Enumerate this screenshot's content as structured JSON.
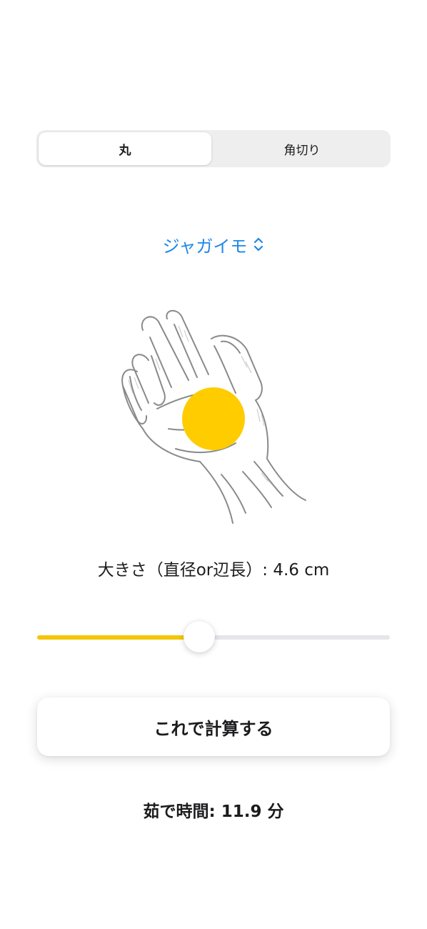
{
  "shape_selector": {
    "options": [
      "丸",
      "角切り"
    ],
    "selected_index": 0
  },
  "ingredient_picker": {
    "label": "ジャガイモ",
    "icon": "chevron-up-down-icon"
  },
  "illustration": {
    "name": "hand-with-circle",
    "circle_color": "#ffcc00"
  },
  "size": {
    "label": "大きさ（直径or辺長）: 4.6 cm",
    "value_cm": 4.6,
    "slider_fraction": 0.46
  },
  "calculate_button": {
    "label": "これで計算する"
  },
  "result": {
    "label": "茹で時間: 11.9 分"
  },
  "colors": {
    "accent_blue": "#1e88e5",
    "slider_fill": "#f5c500",
    "slider_track": "#e5e5ea"
  }
}
